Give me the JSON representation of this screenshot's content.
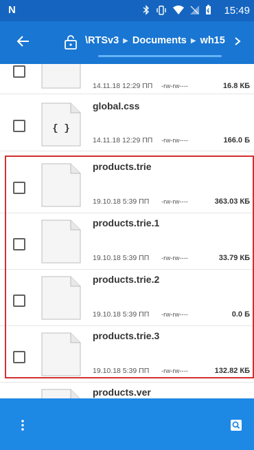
{
  "status_bar": {
    "carrier_logo": "N",
    "time": "15:49",
    "icons": [
      "bluetooth-icon",
      "vibrate-icon",
      "wifi-icon",
      "no-signal-icon",
      "battery-icon"
    ]
  },
  "toolbar": {
    "breadcrumb": [
      "\\RTSv3",
      "Documents",
      "wh15"
    ],
    "separator": "▶",
    "colors": {
      "background": "#1976d2",
      "status": "#1565c0"
    }
  },
  "files": [
    {
      "name": "",
      "date": "14.11.18 12:29 ПП",
      "perm": "-rw-rw----",
      "size": "16.8 КБ",
      "icon": "file-icon"
    },
    {
      "name": "global.css",
      "date": "14.11.18 12:29 ПП",
      "perm": "-rw-rw----",
      "size": "166.0 Б",
      "icon": "css-file-icon",
      "glyph": "{ }"
    },
    {
      "name": "products.trie",
      "date": "19.10.18 5:39 ПП",
      "perm": "-rw-rw----",
      "size": "363.03 КБ",
      "icon": "file-icon"
    },
    {
      "name": "products.trie.1",
      "date": "19.10.18 5:39 ПП",
      "perm": "-rw-rw----",
      "size": "33.79 КБ",
      "icon": "file-icon"
    },
    {
      "name": "products.trie.2",
      "date": "19.10.18 5:39 ПП",
      "perm": "-rw-rw----",
      "size": "0.0 Б",
      "icon": "file-icon"
    },
    {
      "name": "products.trie.3",
      "date": "19.10.18 5:39 ПП",
      "perm": "-rw-rw----",
      "size": "132.82 КБ",
      "icon": "file-icon"
    },
    {
      "name": "products.ver",
      "date": "",
      "perm": "",
      "size": "",
      "icon": "file-icon"
    }
  ],
  "highlight_color": "#d32f2f"
}
